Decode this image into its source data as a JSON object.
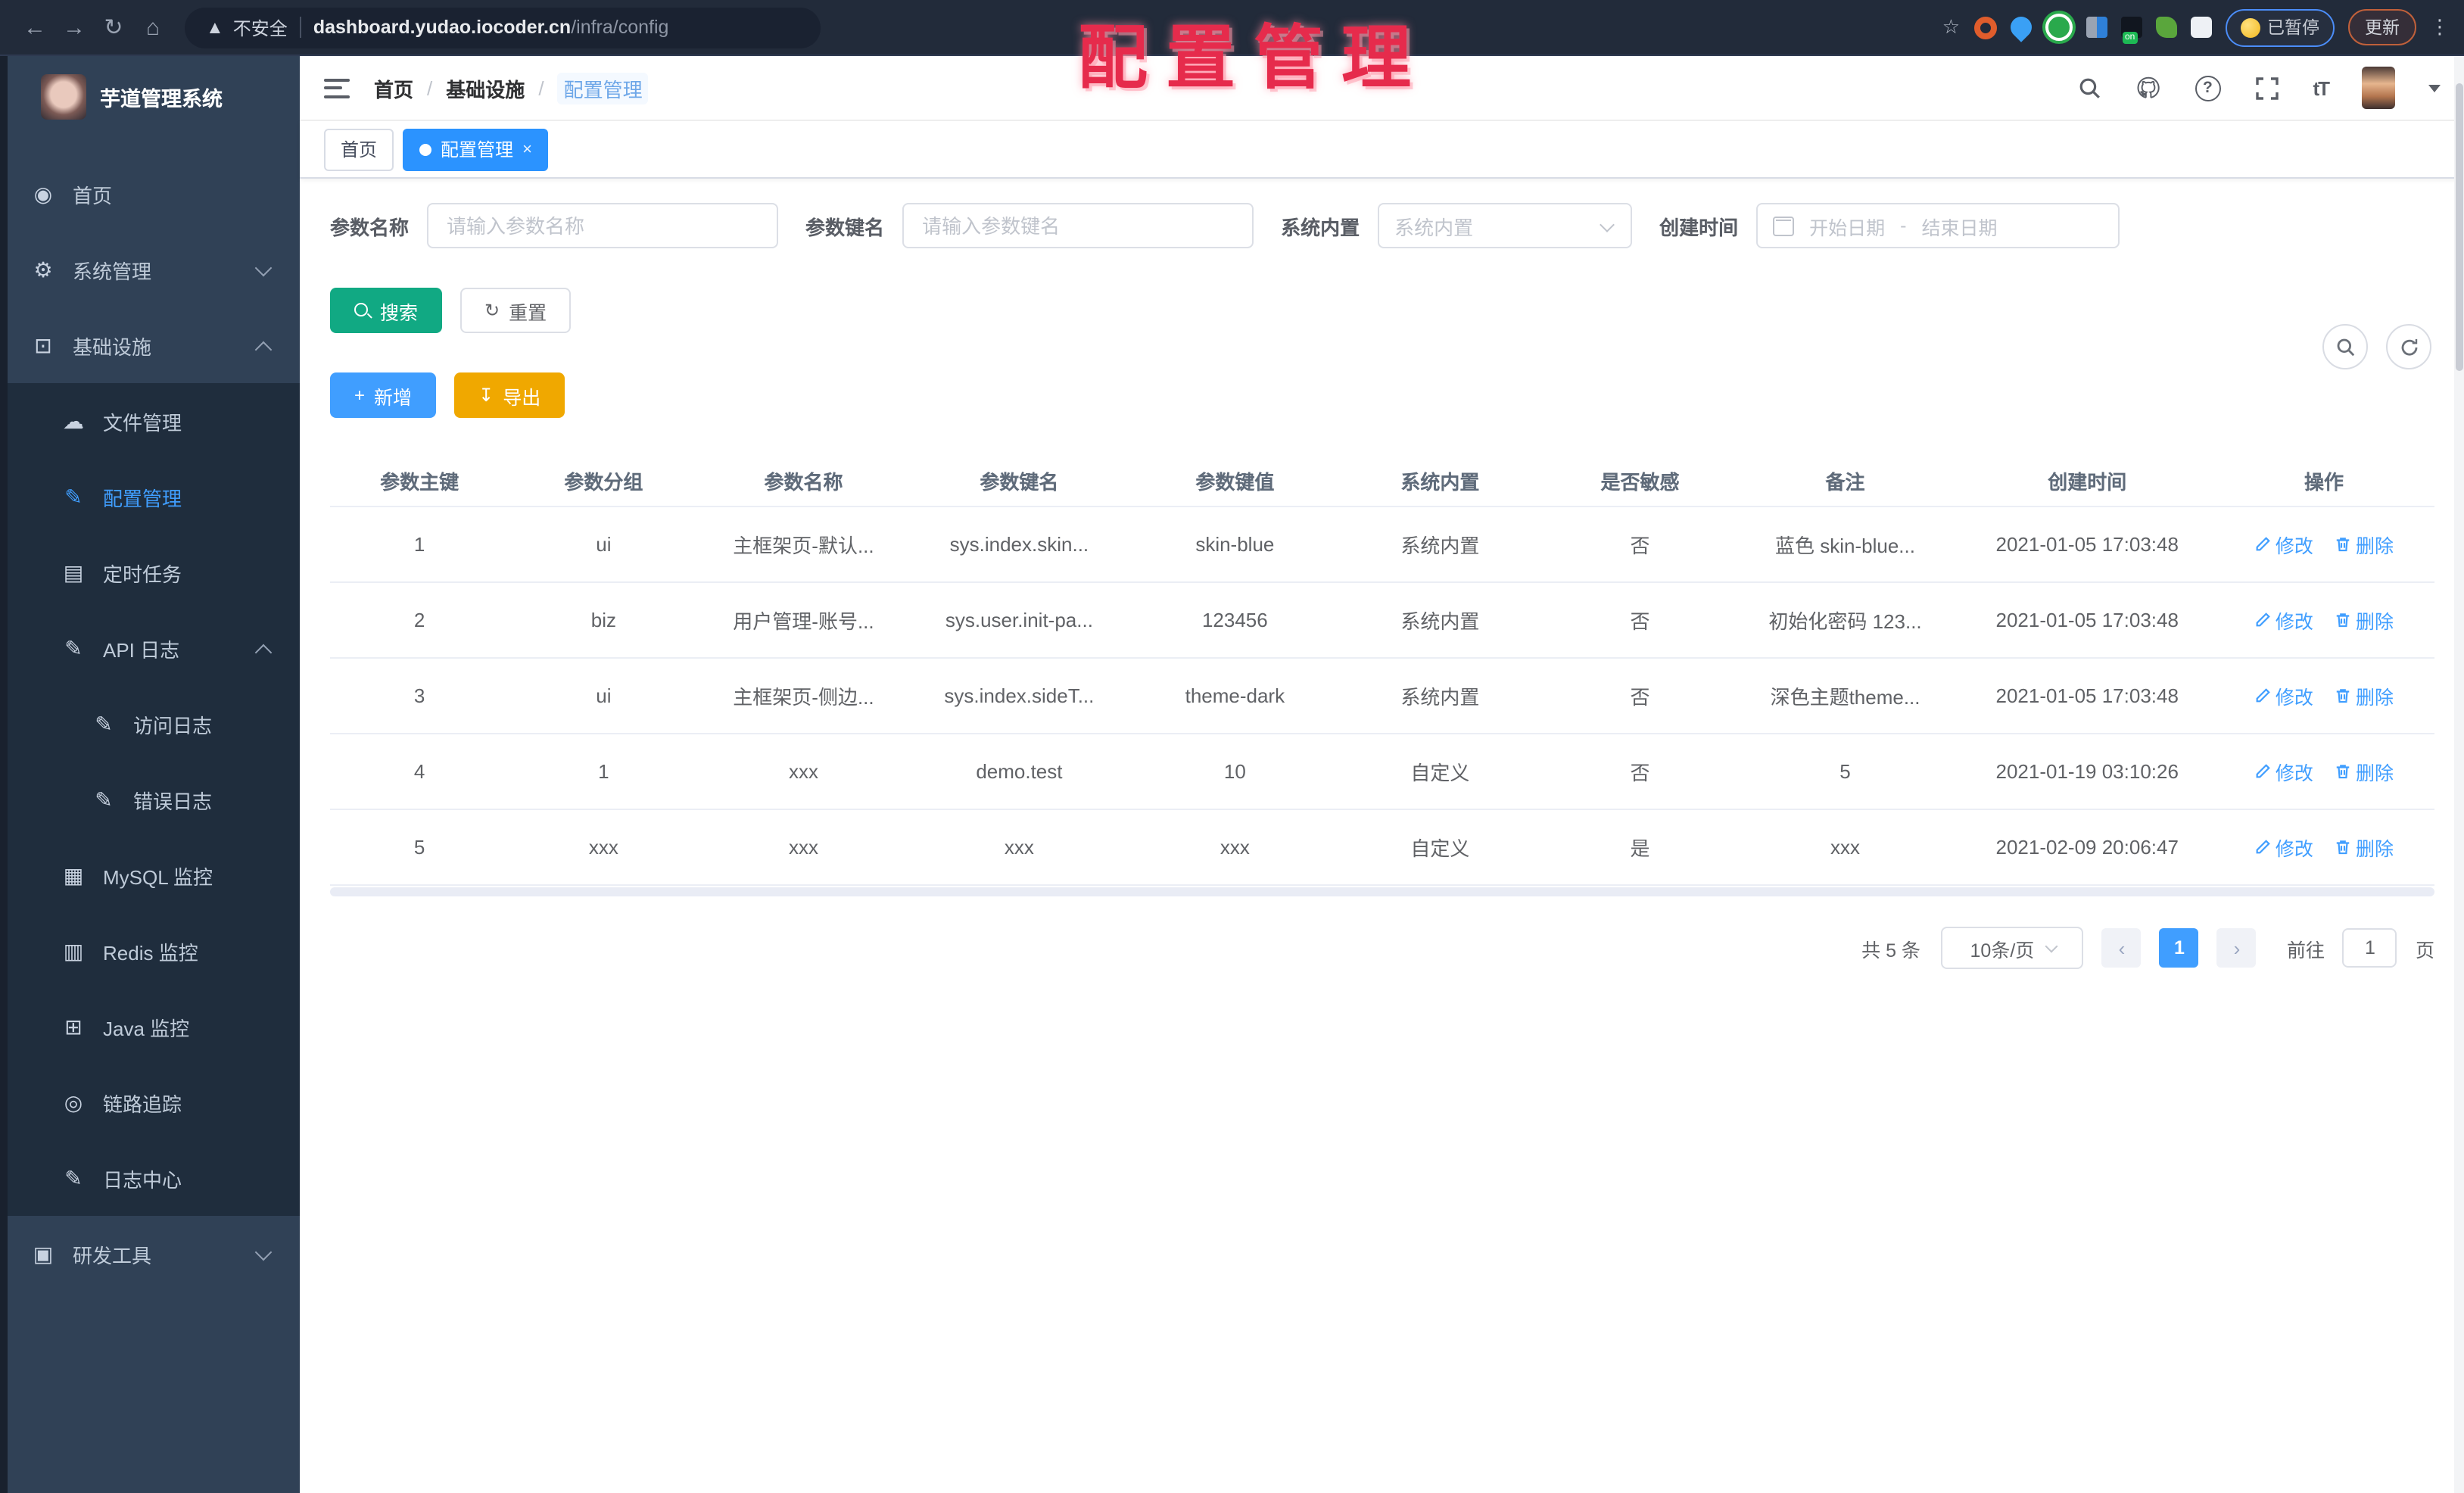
{
  "browser": {
    "security_label": "不安全",
    "url_host": "dashboard.yudao.iocoder.cn",
    "url_path": "/infra/config",
    "extension_on_badge": "on",
    "paused_badge": "已暂停",
    "update_button": "更新"
  },
  "overlay": {
    "title": "配置管理",
    "color": "#e62b4c"
  },
  "sidebar": {
    "title": "芋道管理系统",
    "items": [
      {
        "id": "home",
        "label": "首页",
        "icon": "dashboard-icon",
        "level": 1,
        "sub": false
      },
      {
        "id": "system",
        "label": "系统管理",
        "icon": "gear-icon",
        "level": 1,
        "sub": false,
        "chevron": "down"
      },
      {
        "id": "infra",
        "label": "基础设施",
        "icon": "monitor-icon",
        "level": 1,
        "sub": false,
        "chevron": "up"
      },
      {
        "id": "file",
        "label": "文件管理",
        "icon": "cloud-icon",
        "level": 2,
        "sub": true
      },
      {
        "id": "config",
        "label": "配置管理",
        "icon": "edit-icon",
        "level": 2,
        "sub": true,
        "active": true
      },
      {
        "id": "job",
        "label": "定时任务",
        "icon": "document-icon",
        "level": 2,
        "sub": true
      },
      {
        "id": "api-log",
        "label": "API 日志",
        "icon": "log-icon",
        "level": 2,
        "sub": true,
        "chevron": "up"
      },
      {
        "id": "access-log",
        "label": "访问日志",
        "icon": "log-icon",
        "level": 3,
        "sub": true
      },
      {
        "id": "error-log",
        "label": "错误日志",
        "icon": "log-icon",
        "level": 3,
        "sub": true
      },
      {
        "id": "mysql",
        "label": "MySQL 监控",
        "icon": "mysql-icon",
        "level": 2,
        "sub": true
      },
      {
        "id": "redis",
        "label": "Redis 监控",
        "icon": "redis-icon",
        "level": 2,
        "sub": true
      },
      {
        "id": "java",
        "label": "Java 监控",
        "icon": "java-icon",
        "level": 2,
        "sub": true
      },
      {
        "id": "trace",
        "label": "链路追踪",
        "icon": "eye-icon",
        "level": 2,
        "sub": true
      },
      {
        "id": "log-center",
        "label": "日志中心",
        "icon": "log-icon",
        "level": 2,
        "sub": true
      },
      {
        "id": "devtools",
        "label": "研发工具",
        "icon": "briefcase-icon",
        "level": 1,
        "sub": false,
        "chevron": "down"
      }
    ]
  },
  "breadcrumb": [
    "首页",
    "基础设施",
    "配置管理"
  ],
  "tabs": [
    {
      "label": "首页",
      "active": false,
      "closable": false
    },
    {
      "label": "配置管理",
      "active": true,
      "closable": true
    }
  ],
  "filters": {
    "name_label": "参数名称",
    "name_placeholder": "请输入参数名称",
    "key_label": "参数键名",
    "key_placeholder": "请输入参数键名",
    "type_label": "系统内置",
    "type_placeholder": "系统内置",
    "date_label": "创建时间",
    "date_start_placeholder": "开始日期",
    "date_separator": "-",
    "date_end_placeholder": "结束日期"
  },
  "actions": {
    "search": "搜索",
    "reset": "重置",
    "add": "新增",
    "export": "导出"
  },
  "table": {
    "headers": [
      "参数主键",
      "参数分组",
      "参数名称",
      "参数键名",
      "参数键值",
      "系统内置",
      "是否敏感",
      "备注",
      "创建时间",
      "操作"
    ],
    "edit_label": "修改",
    "delete_label": "删除",
    "rows": [
      [
        "1",
        "ui",
        "主框架页-默认...",
        "sys.index.skin...",
        "skin-blue",
        "系统内置",
        "否",
        "蓝色 skin-blue...",
        "2021-01-05 17:03:48"
      ],
      [
        "2",
        "biz",
        "用户管理-账号...",
        "sys.user.init-pa...",
        "123456",
        "系统内置",
        "否",
        "初始化密码 123...",
        "2021-01-05 17:03:48"
      ],
      [
        "3",
        "ui",
        "主框架页-侧边...",
        "sys.index.sideT...",
        "theme-dark",
        "系统内置",
        "否",
        "深色主题theme...",
        "2021-01-05 17:03:48"
      ],
      [
        "4",
        "1",
        "xxx",
        "demo.test",
        "10",
        "自定义",
        "否",
        "5",
        "2021-01-19 03:10:26"
      ],
      [
        "5",
        "xxx",
        "xxx",
        "xxx",
        "xxx",
        "自定义",
        "是",
        "xxx",
        "2021-02-09 20:06:47"
      ]
    ]
  },
  "pagination": {
    "total_label": "共 5 条",
    "page_size": "10条/页",
    "current_page": "1",
    "goto_label": "前往",
    "goto_value": "1",
    "page_unit": "页"
  },
  "colors": {
    "accent": "#409eff",
    "search_button": "#11a983",
    "export_button": "#f0a800",
    "sidebar_bg": "#304156",
    "submenu_bg": "#1f2d3d",
    "overlay_red": "#e62b4c",
    "active_tab": "#2b93ff"
  }
}
